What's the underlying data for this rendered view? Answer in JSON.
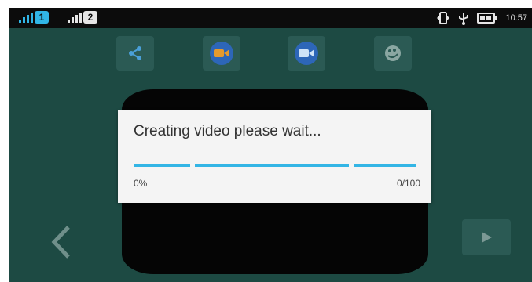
{
  "status_bar": {
    "sim1_label": "1",
    "sim2_label": "2",
    "time": "10:57",
    "icons": [
      "signal-icon",
      "signal-icon",
      "rotate-icon",
      "usb-icon",
      "battery-icon"
    ]
  },
  "toolbar": {
    "buttons": [
      {
        "name": "share-button",
        "icon": "share-icon"
      },
      {
        "name": "video-orange-button",
        "icon": "video-camera-icon"
      },
      {
        "name": "video-blue-button",
        "icon": "video-camera-icon"
      },
      {
        "name": "settings-button",
        "icon": "palette-icon"
      }
    ]
  },
  "dialog": {
    "message": "Creating video please wait...",
    "progress_percent_label": "0%",
    "progress_count_label": "0/100",
    "progress_value": 0,
    "progress_max": 100
  },
  "nav": {
    "prev_icon": "chevron-left-icon",
    "play_icon": "play-icon"
  },
  "colors": {
    "background": "#1d4a43",
    "button_bg": "#2b5a54",
    "accent_blue": "#33b5e5",
    "accent_orange": "#e59a2d",
    "dialog_bg": "#f4f4f4"
  }
}
